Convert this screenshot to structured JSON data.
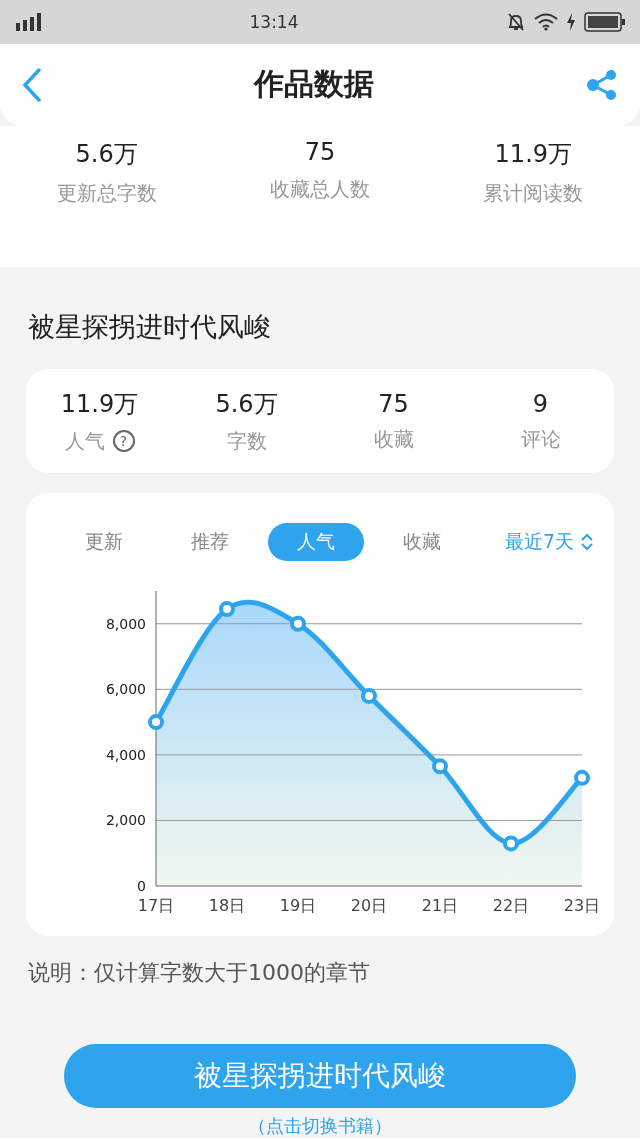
{
  "status_bar": {
    "time": "13:14"
  },
  "header": {
    "title": "作品数据"
  },
  "summary": [
    {
      "value": "5.6万",
      "label": "更新总字数"
    },
    {
      "value": "75",
      "label": "收藏总人数"
    },
    {
      "value": "11.9万",
      "label": "累计阅读数"
    }
  ],
  "book": {
    "title": "被星探拐进时代风峻"
  },
  "book_stats": [
    {
      "value": "11.9万",
      "label": "人气",
      "help": "?"
    },
    {
      "value": "5.6万",
      "label": "字数"
    },
    {
      "value": "75",
      "label": "收藏"
    },
    {
      "value": "9",
      "label": "评论"
    }
  ],
  "chart_tabs": [
    {
      "label": "更新",
      "selected": false
    },
    {
      "label": "推荐",
      "selected": false
    },
    {
      "label": "人气",
      "selected": true
    },
    {
      "label": "收藏",
      "selected": false
    }
  ],
  "range_select": {
    "value": "最近7天"
  },
  "chart_data": {
    "type": "area",
    "categories": [
      "17日",
      "18日",
      "19日",
      "20日",
      "21日",
      "22日",
      "23日"
    ],
    "ylim": [
      0,
      9000
    ],
    "grid": true,
    "yticks": [
      {
        "value": 0,
        "label": "0"
      },
      {
        "value": 2000,
        "label": "2,000"
      },
      {
        "value": 4000,
        "label": "4,000"
      },
      {
        "value": 6000,
        "label": "6,000"
      },
      {
        "value": 8000,
        "label": "8,000"
      }
    ],
    "series": [
      {
        "color": "#2ea3ee",
        "values": [
          5000,
          8450,
          8000,
          5800,
          3650,
          1300,
          3300
        ]
      }
    ]
  },
  "note": "说明：仅计算字数大于1000的章节",
  "switch_button": {
    "label": "被星探拐进时代风峻"
  },
  "switch_link": "（点击切换书籍）"
}
